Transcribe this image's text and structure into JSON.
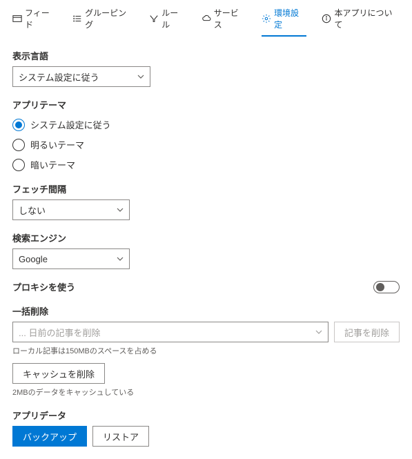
{
  "tabs": {
    "feed": "フィード",
    "grouping": "グルーピング",
    "rules": "ルール",
    "service": "サービス",
    "settings": "環境設定",
    "about": "本アプリについて"
  },
  "display_language": {
    "label": "表示言語",
    "value": "システム設定に従う"
  },
  "app_theme": {
    "label": "アプリテーマ",
    "options": {
      "system": "システム設定に従う",
      "light": "明るいテーマ",
      "dark": "暗いテーマ"
    }
  },
  "fetch_interval": {
    "label": "フェッチ間隔",
    "value": "しない"
  },
  "search_engine": {
    "label": "検索エンジン",
    "value": "Google"
  },
  "proxy": {
    "label": "プロキシを使う"
  },
  "bulk_delete": {
    "label": "一括削除",
    "placeholder": "... 日前の記事を削除",
    "delete_btn": "記事を削除",
    "storage_hint": "ローカル記事は150MBのスペースを占める",
    "clear_cache_btn": "キャッシュを削除",
    "cache_hint": "2MBのデータをキャッシュしている"
  },
  "app_data": {
    "label": "アプリデータ",
    "backup_btn": "バックアップ",
    "restore_btn": "リストア"
  }
}
